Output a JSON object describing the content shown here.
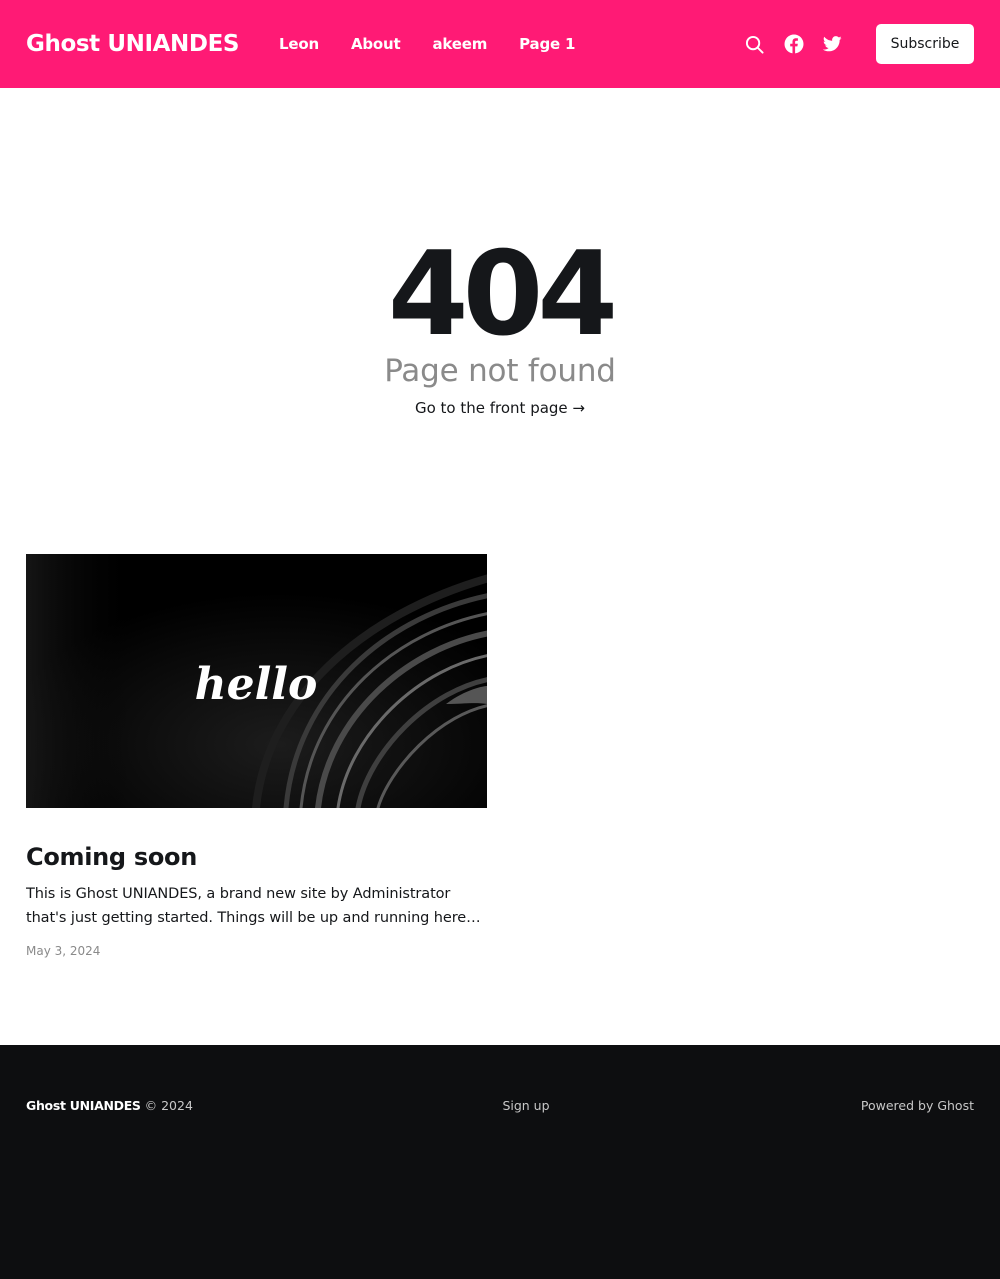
{
  "header": {
    "brand": "Ghost UNIANDES",
    "nav": [
      "Leon",
      "About",
      "akeem",
      "Page 1"
    ],
    "subscribe_label": "Subscribe",
    "icons": [
      "search-icon",
      "facebook-icon",
      "twitter-icon"
    ],
    "background_color": "#ff1a75"
  },
  "error": {
    "code": "404",
    "description": "Page not found",
    "link_text": "Go to the front page →"
  },
  "post": {
    "image_text": "hello",
    "title": "Coming soon",
    "excerpt": "This is Ghost UNIANDES, a brand new site by Administrator that's just getting started. Things will be up and running here shortly, you can subscribe in the meantime if you'd like to stay up to date and receive emails when new content is published!",
    "date": "May 3, 2024"
  },
  "footer": {
    "site_name": "Ghost UNIANDES",
    "copyright": "© 2024",
    "signup_label": "Sign up",
    "powered_by": "Powered by Ghost",
    "background_color": "#0d0e10"
  }
}
